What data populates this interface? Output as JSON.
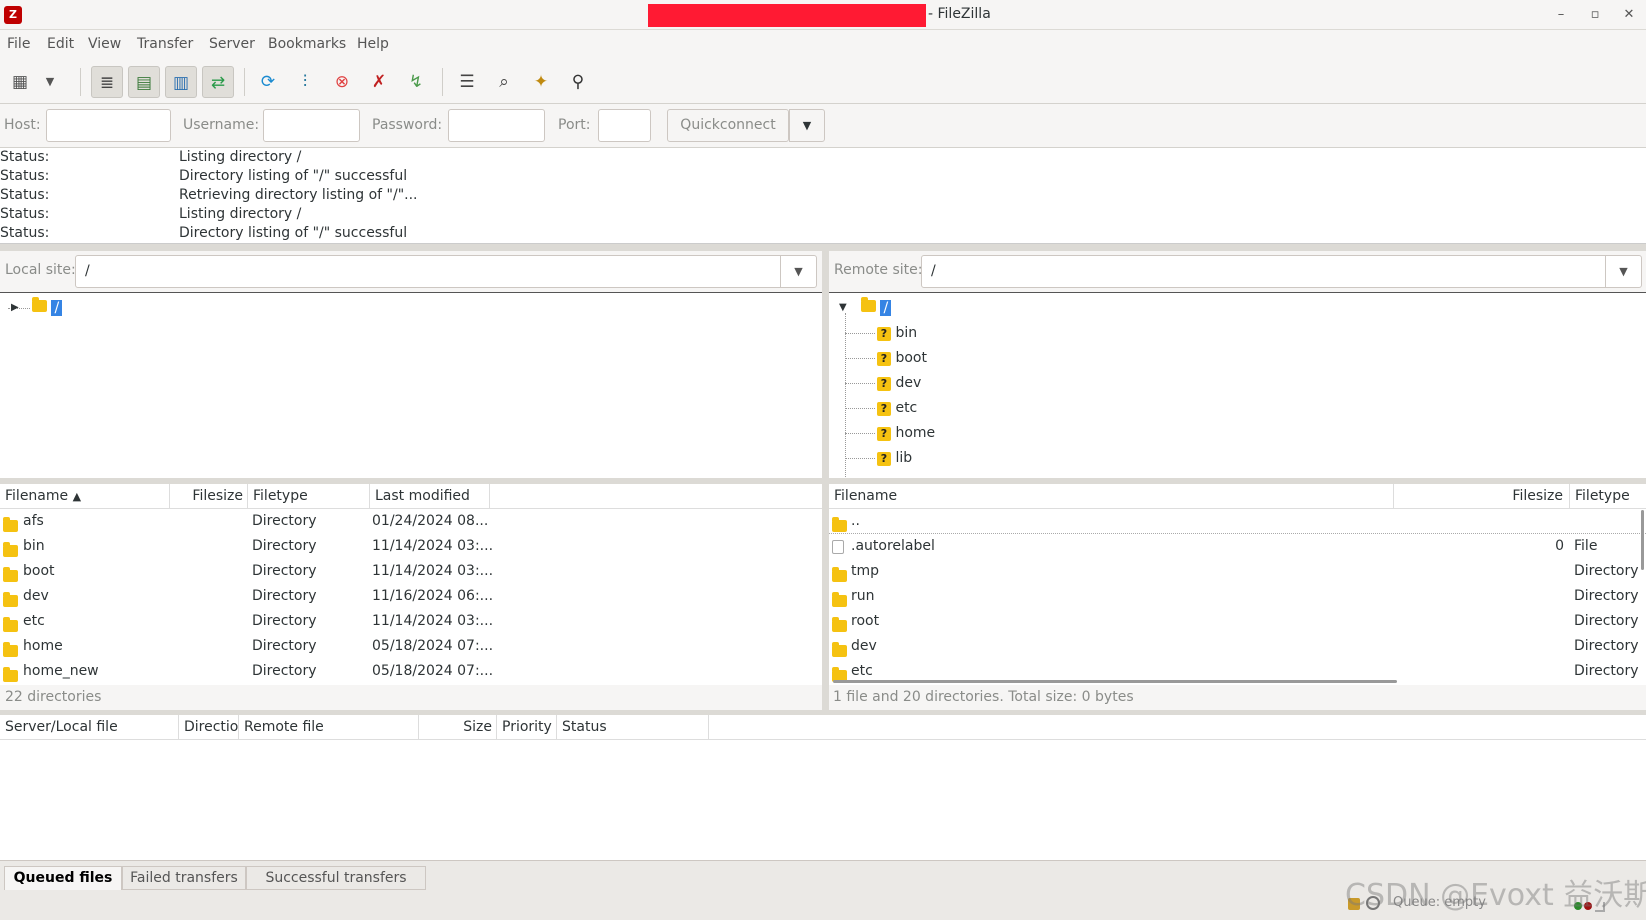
{
  "window": {
    "title": "- FileZilla"
  },
  "menu": [
    "File",
    "Edit",
    "View",
    "Transfer",
    "Server",
    "Bookmarks",
    "Help"
  ],
  "quickconnect": {
    "host_label": "Host:",
    "username_label": "Username:",
    "password_label": "Password:",
    "port_label": "Port:",
    "button": "Quickconnect"
  },
  "log": [
    {
      "k": "Status:",
      "v": "Listing directory /"
    },
    {
      "k": "Status:",
      "v": "Directory listing of \"/\" successful"
    },
    {
      "k": "Status:",
      "v": "Retrieving directory listing of \"/\"..."
    },
    {
      "k": "Status:",
      "v": "Listing directory /"
    },
    {
      "k": "Status:",
      "v": "Directory listing of \"/\" successful"
    }
  ],
  "local": {
    "label": "Local site:",
    "path": "/",
    "tree_root": "/",
    "columns": [
      "Filename",
      "Filesize",
      "Filetype",
      "Last modified"
    ],
    "files": [
      {
        "name": "afs",
        "size": "",
        "type": "Directory",
        "modified": "01/24/2024 08..."
      },
      {
        "name": "bin",
        "size": "",
        "type": "Directory",
        "modified": "11/14/2024 03:..."
      },
      {
        "name": "boot",
        "size": "",
        "type": "Directory",
        "modified": "11/14/2024 03:..."
      },
      {
        "name": "dev",
        "size": "",
        "type": "Directory",
        "modified": "11/16/2024 06:..."
      },
      {
        "name": "etc",
        "size": "",
        "type": "Directory",
        "modified": "11/14/2024 03:..."
      },
      {
        "name": "home",
        "size": "",
        "type": "Directory",
        "modified": "05/18/2024 07:..."
      },
      {
        "name": "home_new",
        "size": "",
        "type": "Directory",
        "modified": "05/18/2024 07:..."
      }
    ],
    "status": "22 directories"
  },
  "remote": {
    "label": "Remote site:",
    "path": "/",
    "tree_root": "/",
    "tree": [
      "bin",
      "boot",
      "dev",
      "etc",
      "home",
      "lib"
    ],
    "columns": [
      "Filename",
      "Filesize",
      "Filetype"
    ],
    "files": [
      {
        "name": "..",
        "size": "",
        "type": "",
        "kind": "folder"
      },
      {
        "name": ".autorelabel",
        "size": "0",
        "type": "File",
        "kind": "file"
      },
      {
        "name": "tmp",
        "size": "",
        "type": "Directory",
        "kind": "folder"
      },
      {
        "name": "run",
        "size": "",
        "type": "Directory",
        "kind": "folder"
      },
      {
        "name": "root",
        "size": "",
        "type": "Directory",
        "kind": "folder"
      },
      {
        "name": "dev",
        "size": "",
        "type": "Directory",
        "kind": "folder"
      },
      {
        "name": "etc",
        "size": "",
        "type": "Directory",
        "kind": "folder"
      }
    ],
    "status": "1 file and 20 directories. Total size: 0 bytes"
  },
  "queue": {
    "columns": [
      "Server/Local file",
      "Directio",
      "Remote file",
      "Size",
      "Priority",
      "Status"
    ],
    "tabs": [
      "Queued files",
      "Failed transfers",
      "Successful transfers"
    ],
    "status": "Queue: empty"
  },
  "watermark": "CSDN @Evoxt 益沃斯"
}
